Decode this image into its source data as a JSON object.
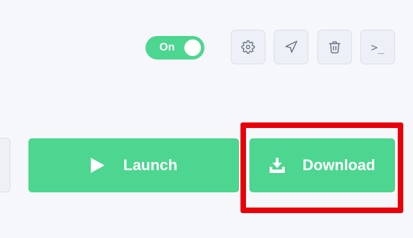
{
  "toggle": {
    "label": "On",
    "state": "on",
    "color": "#4cd68f"
  },
  "toolbar": {
    "icons": [
      "gear-icon",
      "send-icon",
      "trash-icon",
      "terminal-icon"
    ],
    "terminal_glyph": ">_"
  },
  "actions": {
    "launch_label": "Launch",
    "download_label": "Download",
    "color": "#4cd68f"
  },
  "annotation": {
    "color": "#e8000b",
    "target": "download-button"
  }
}
